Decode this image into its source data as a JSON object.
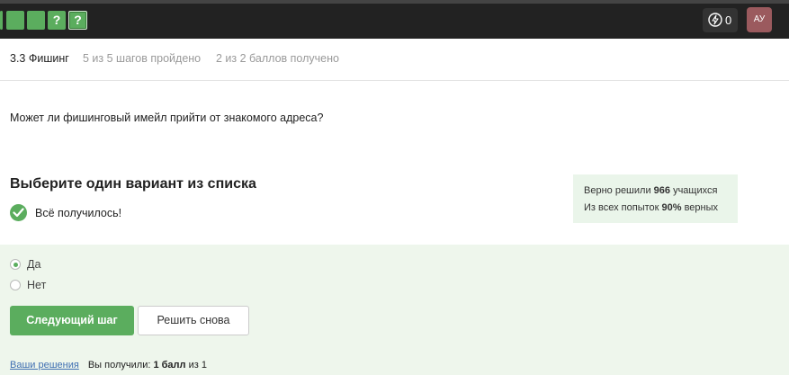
{
  "topbar": {
    "steps": [
      {
        "label": "",
        "state": "passed"
      },
      {
        "label": "",
        "state": "passed"
      },
      {
        "label": "",
        "state": "passed"
      },
      {
        "label": "?",
        "state": "passed-question"
      },
      {
        "label": "?",
        "state": "current-question"
      }
    ],
    "energy_icon": "lightning-icon",
    "energy_count": "0",
    "avatar_initials": "АУ"
  },
  "lesson": {
    "title": "3.3 Фишинг",
    "steps_progress": "5 из 5 шагов пройдено",
    "score": "2 из 2 баллов  получено"
  },
  "question": {
    "text": "Может ли фишинговый имейл прийти от знакомого адреса?",
    "choose_title": "Выберите один вариант из списка",
    "success_icon": "check-circle-icon",
    "success_text": "Всё получилось!"
  },
  "stats": {
    "line1_prefix": "Верно решили ",
    "line1_count": "966",
    "line1_suffix": " учащихся",
    "line2_prefix": "Из всех попыток ",
    "line2_percent": "90%",
    "line2_suffix": " верных"
  },
  "options": [
    {
      "label": "Да",
      "selected": true
    },
    {
      "label": "Нет",
      "selected": false
    }
  ],
  "actions": {
    "next_label": "Следующий шаг",
    "retry_label": "Решить снова"
  },
  "footer": {
    "solutions_link": "Ваши решения",
    "got_prefix": "Вы получили: ",
    "got_value": "1 балл",
    "got_mid": " из ",
    "got_total": "1"
  },
  "colors": {
    "accent_green": "#5bad5e",
    "topbar_bg": "#222222",
    "options_bg": "#eef6ec",
    "link_blue": "#3f6fb2"
  }
}
